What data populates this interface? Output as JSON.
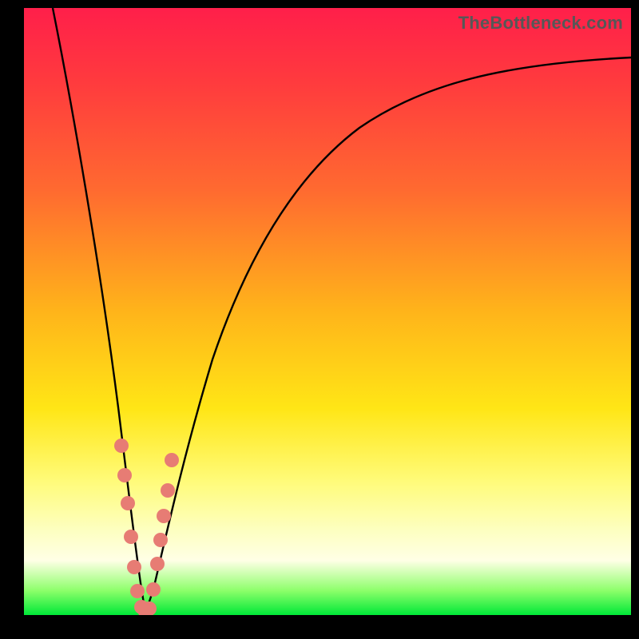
{
  "watermark": "TheBottleneck.com",
  "colors": {
    "background": "#000000",
    "watermark_text": "#575757",
    "curve_stroke": "#000000",
    "dot_fill": "#e77c74",
    "gradient_stops": [
      "#ff1f4a",
      "#ff3a3e",
      "#ff6a30",
      "#ffb41a",
      "#ffe616",
      "#fffb7a",
      "#fdffc0",
      "#ffffe6",
      "#8cff6a",
      "#00e838"
    ]
  },
  "chart_data": {
    "type": "line",
    "title": "",
    "xlabel": "",
    "ylabel": "",
    "xlim": [
      0,
      100
    ],
    "ylim": [
      0,
      100
    ],
    "note": "V-shaped bottleneck curve; values are bottleneck % vs a normalized x-axis, estimated from the plot.",
    "series": [
      {
        "name": "bottleneck-curve",
        "x": [
          0,
          4,
          8,
          12,
          14,
          16,
          17,
          18,
          19,
          20,
          21,
          22,
          23,
          24,
          26,
          28,
          30,
          34,
          38,
          44,
          50,
          58,
          66,
          76,
          86,
          100
        ],
        "values": [
          100,
          87,
          72,
          55,
          44,
          30,
          20,
          11,
          4,
          0,
          3,
          9,
          18,
          26,
          38,
          48,
          55,
          64,
          70,
          76,
          80,
          84,
          86,
          88,
          89,
          90
        ]
      }
    ],
    "markers": {
      "name": "highlighted-points",
      "note": "Salmon dots clustered around the dip on both branches (approx readings).",
      "x": [
        16.0,
        16.6,
        17.2,
        17.8,
        18.2,
        18.8,
        19.3,
        19.8,
        20.3,
        21.1,
        21.8,
        22.3,
        22.7,
        23.2,
        23.9
      ],
      "values": [
        28,
        23,
        18,
        12,
        8,
        4,
        2,
        1,
        1,
        4,
        9,
        13,
        16,
        20,
        26
      ]
    }
  }
}
